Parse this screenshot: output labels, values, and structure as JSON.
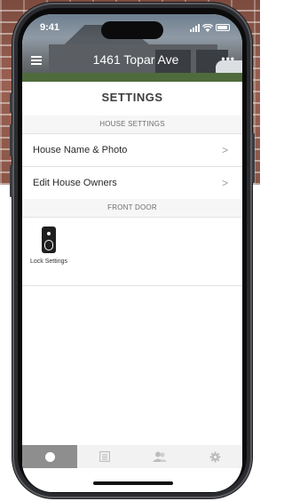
{
  "status_bar": {
    "time": "9:41"
  },
  "header": {
    "house_name": "1461 Topar Ave",
    "menu_icon": "hamburger-menu-icon",
    "more_icon": "more-dots-icon",
    "more_glyph": "•••"
  },
  "page": {
    "title": "SETTINGS"
  },
  "house_settings": {
    "header": "HOUSE SETTINGS",
    "items": [
      {
        "label": "House Name & Photo",
        "chevron": ">"
      },
      {
        "label": "Edit House Owners",
        "chevron": ">"
      }
    ]
  },
  "front_door": {
    "header": "FRONT DOOR",
    "tiles": [
      {
        "label": "Lock Settings",
        "icon": "smart-lock-icon"
      }
    ]
  },
  "tab_bar": {
    "tabs": [
      {
        "icon": "circle-dot-icon",
        "active": true
      },
      {
        "icon": "list-icon",
        "active": false
      },
      {
        "icon": "users-icon",
        "active": false
      },
      {
        "icon": "gear-icon",
        "active": false
      }
    ]
  },
  "colors": {
    "active_tab": "#8e8e8e",
    "tab_bar_bg": "#f2f2f2",
    "section_bg": "#f6f6f6"
  }
}
